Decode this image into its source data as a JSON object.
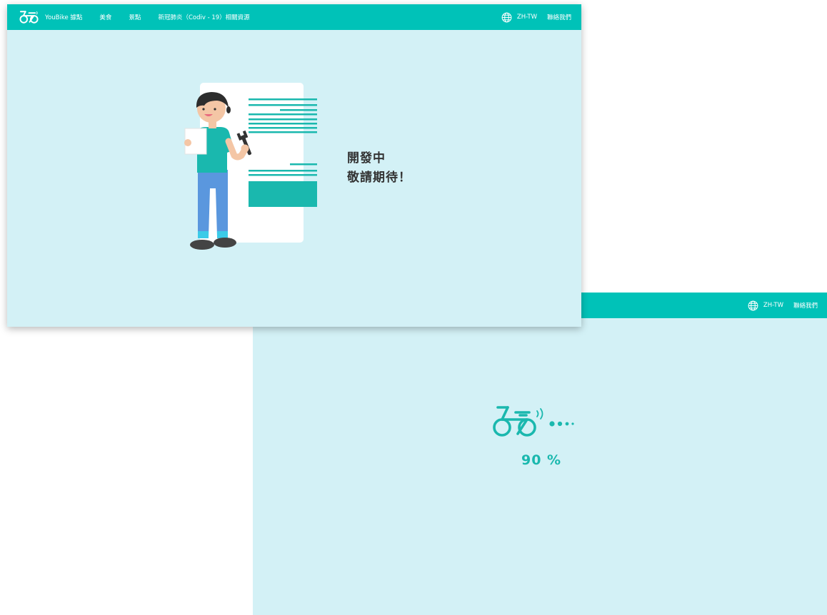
{
  "colors": {
    "nav": "#00c2b8",
    "page_background": "#d3f1f6",
    "accent": "#1ab8ae",
    "text": "#333333"
  },
  "front_screen": {
    "nav": {
      "brand_label": "YouBike 據點",
      "links": [
        "美食",
        "景點",
        "新冠肺炎（Codiv - 19）相關資源"
      ],
      "language": "ZH-TW",
      "contact": "聯絡我們"
    },
    "message": {
      "line1": "開發中",
      "line2": "敬請期待！"
    },
    "icons": {
      "logo": "bike-logo-icon",
      "language": "globe-icon",
      "illustration": "developer-illustration"
    }
  },
  "back_screen": {
    "nav": {
      "language": "ZH-TW",
      "contact": "聯絡我們"
    },
    "loading": {
      "progress_percent": 90,
      "label": "90 %"
    },
    "icons": {
      "language": "globe-icon",
      "loader": "bike-loading-icon"
    }
  }
}
